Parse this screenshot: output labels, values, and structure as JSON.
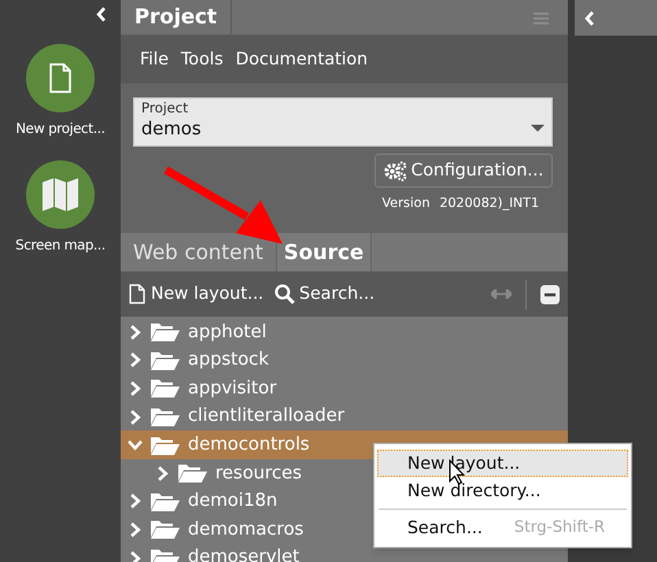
{
  "sidebar": {
    "items": [
      {
        "kind": "file",
        "label": "New project..."
      },
      {
        "kind": "map",
        "label": "Screen map..."
      }
    ]
  },
  "panel": {
    "title": "Project",
    "menu": [
      "File",
      "Tools",
      "Documentation"
    ],
    "project_select": {
      "label": "Project",
      "value": "demos"
    },
    "configuration_button": "Configuration...",
    "version": {
      "label": "Version",
      "value": "2020082)_INT1"
    },
    "tabs": [
      {
        "label": "Web content",
        "selected": false
      },
      {
        "label": "Source",
        "selected": true
      }
    ],
    "toolbar": {
      "new_layout": "New layout...",
      "search": "Search..."
    },
    "tree": [
      {
        "label": "apphotel",
        "expanded": false,
        "selected": false
      },
      {
        "label": "appstock",
        "expanded": false,
        "selected": false
      },
      {
        "label": "appvisitor",
        "expanded": false,
        "selected": false
      },
      {
        "label": "clientliteralloader",
        "expanded": false,
        "selected": false
      },
      {
        "label": "democontrols",
        "expanded": true,
        "selected": true,
        "children": [
          {
            "label": "resources",
            "expanded": false,
            "selected": false
          }
        ]
      },
      {
        "label": "demoi18n",
        "expanded": false,
        "selected": false
      },
      {
        "label": "demomacros",
        "expanded": false,
        "selected": false
      },
      {
        "label": "demoservlet",
        "expanded": false,
        "selected": false
      }
    ]
  },
  "context_menu": [
    {
      "label": "New layout...",
      "selected": true,
      "separator_before": false
    },
    {
      "label": "New directory...",
      "selected": false,
      "separator_before": false
    },
    {
      "label": "Search...",
      "shortcut": "Strg-Shift-R",
      "selected": false,
      "separator_before": true
    }
  ]
}
